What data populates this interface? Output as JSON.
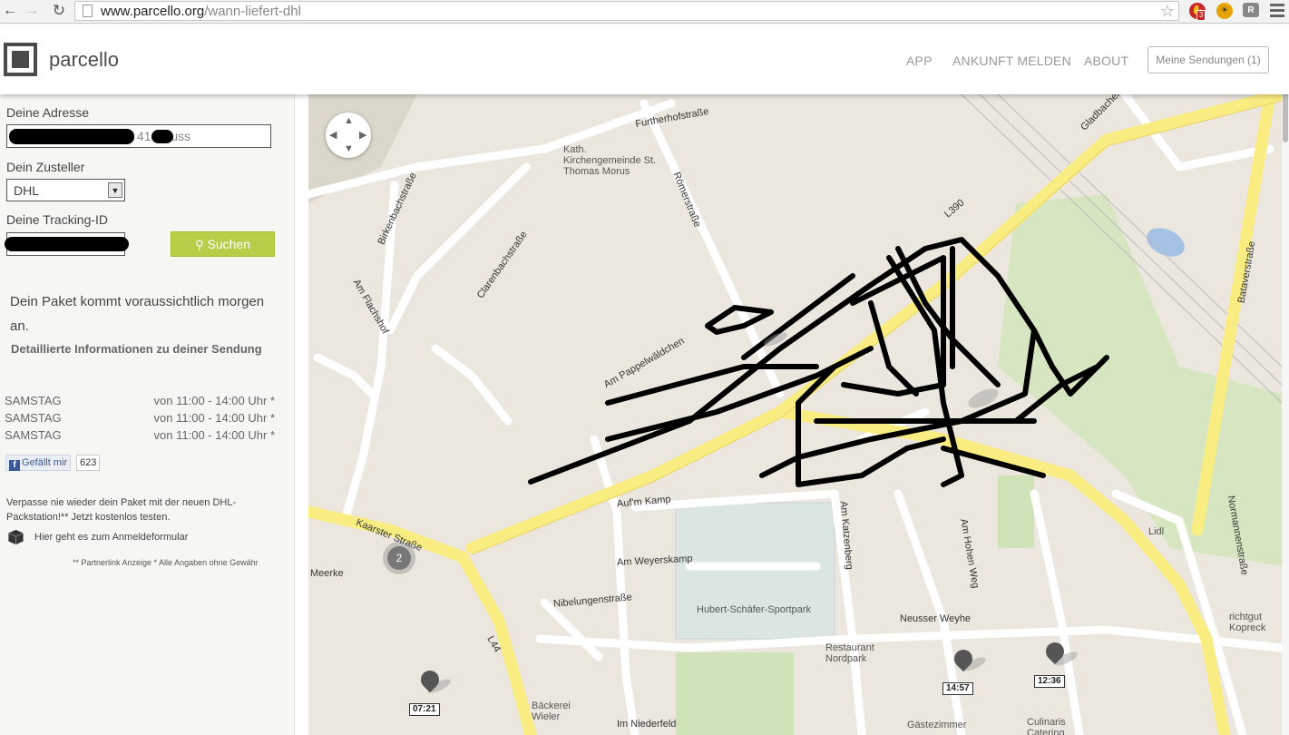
{
  "browser": {
    "url_domain": "www.parcello.org",
    "url_path": "/wann-liefert-dhl",
    "adblock_badge": "3"
  },
  "header": {
    "logo_text": "parcello",
    "nav": [
      "APP",
      "ANKUNFT MELDEN",
      "ABOUT"
    ],
    "sendungen_button": "Meine Sendungen (1)"
  },
  "form": {
    "address_label": "Deine Adresse",
    "address_value": "41  Neuss",
    "carrier_label": "Dein Zusteller",
    "carrier_value": "DHL",
    "tracking_label": "Deine Tracking-ID",
    "search_button": "Suchen"
  },
  "status": {
    "message": "Dein Paket kommt voraussichtlich morgen an.",
    "details_link": "Detaillierte Informationen zu deiner Sendung"
  },
  "schedule": [
    {
      "day": "SAMSTAG",
      "time": "von 11:00 - 14:00 Uhr *"
    },
    {
      "day": "SAMSTAG",
      "time": "von 11:00 - 14:00 Uhr *"
    },
    {
      "day": "SAMSTAG",
      "time": "von 11:00 - 14:00 Uhr *"
    }
  ],
  "facebook": {
    "label": "Gefällt mir",
    "count": "623"
  },
  "promo": {
    "text": "Verpasse nie wieder dein Paket mit der neuen DHL-Packstation!** Jetzt kostenlos testen.",
    "link": "Hier geht es zum Anmeldeformular",
    "fineprint": "** Partnerlink Anzeige * Alle Angaben ohne Gewähr"
  },
  "map": {
    "cluster_count": "2",
    "pins": [
      {
        "label": "07:21"
      },
      {
        "label": "14:57"
      },
      {
        "label": "12:36"
      }
    ],
    "road_labels": [
      "Furtherhofstraße",
      "L390",
      "Römerstraße",
      "Bataverstraße",
      "Auf'm Kamp",
      "Am Weyerskamp",
      "Nibelungenstraße",
      "Neusser Weyhe",
      "Am Katzenberg",
      "Am Hohen Weg",
      "Kaarster Straße",
      "L44",
      "Meerke",
      "Am Flachshof",
      "Clarenbachstraße",
      "Birkenbachstraße",
      "Am Pappelwäldchen",
      "Normannenstraße",
      "Gladbacher",
      "Im Niederfeld"
    ],
    "poi_labels": [
      "Kath. Kirchengemeinde St. Thomas Morus",
      "Hubert-Schäfer-Sportpark",
      "Restaurant Nordpark",
      "Bäckerei Wieler",
      "Lidl",
      "richtgut Kopreck",
      "Gästezimmer",
      "Culinaris Catering"
    ]
  }
}
